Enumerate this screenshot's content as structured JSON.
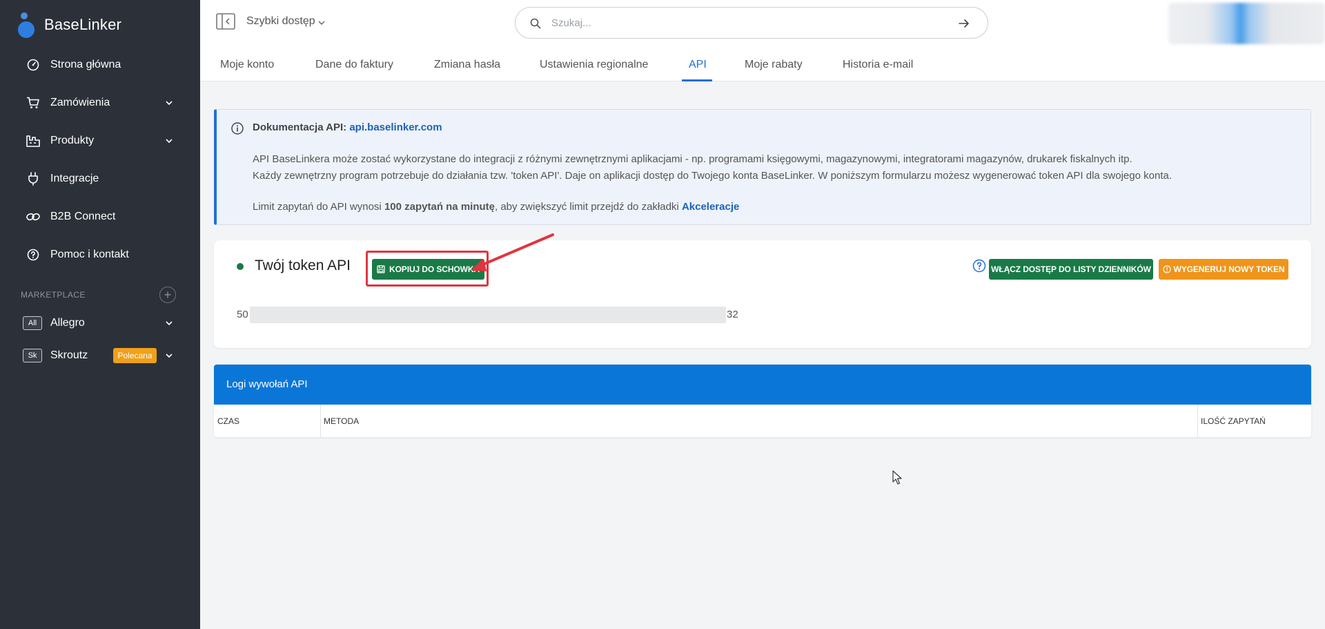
{
  "sidebar": {
    "logo": "BaseLinker",
    "items": [
      {
        "label": "Strona główna",
        "icon": "dashboard-icon"
      },
      {
        "label": "Zamówienia",
        "icon": "cart-icon"
      },
      {
        "label": "Produkty",
        "icon": "products-icon"
      },
      {
        "label": "Integracje",
        "icon": "plug-icon"
      },
      {
        "label": "B2B Connect",
        "icon": "link-icon"
      },
      {
        "label": "Pomoc i kontakt",
        "icon": "help-icon"
      }
    ],
    "marketplace_label": "MARKETPLACE",
    "marketplaces": [
      {
        "badge": "All",
        "label": "Allegro"
      },
      {
        "badge": "Sk",
        "label": "Skroutz",
        "promo": "Polecana"
      }
    ]
  },
  "header": {
    "quick_access": "Szybki dostęp",
    "search_placeholder": "Szukaj...",
    "tabs": [
      "Moje konto",
      "Dane do faktury",
      "Zmiana hasła",
      "Ustawienia regionalne",
      "API",
      "Moje rabaty",
      "Historia e-mail"
    ],
    "active_tab": "API"
  },
  "info": {
    "doc_label": "Dokumentacja API:",
    "doc_link": "api.baselinker.com",
    "p1": "API BaseLinkera może zostać wykorzystane do integracji z różnymi zewnętrznymi aplikacjami - np. programami księgowymi, magazynowymi, integratorami magazynów, drukarek fiskalnych itp.",
    "p2": "Każdy zewnętrzny program potrzebuje do działania tzw. 'token API'. Daje on aplikacji dostęp do Twojego konta BaseLinker. W poniższym formularzu możesz wygenerować token API dla swojego konta.",
    "p3_pre": "Limit zapytań do API wynosi ",
    "p3_bold": "100 zapytań na minutę",
    "p3_mid": ", aby zwiększyć limit przejdź do zakładki ",
    "p3_link": "Akceleracje"
  },
  "token": {
    "title": "Twój token API",
    "copy_button": "KOPIUJ DO SCHOWKA",
    "logs_button": "WŁĄCZ DOSTĘP DO LISTY DZIENNIKÓW",
    "generate_button": "WYGENERUJ NOWY TOKEN",
    "prefix": "50",
    "suffix": "32",
    "status_color": "#1a7a47"
  },
  "logs": {
    "title": "Logi wywołań API",
    "columns": [
      "CZAS",
      "METODA",
      "ILOŚĆ ZAPYTAŃ"
    ]
  },
  "colors": {
    "sidebar_bg": "#2c3139",
    "accent": "#1f6fd6",
    "green": "#1a7a47",
    "orange": "#f0941a",
    "highlight": "#e0353f"
  }
}
